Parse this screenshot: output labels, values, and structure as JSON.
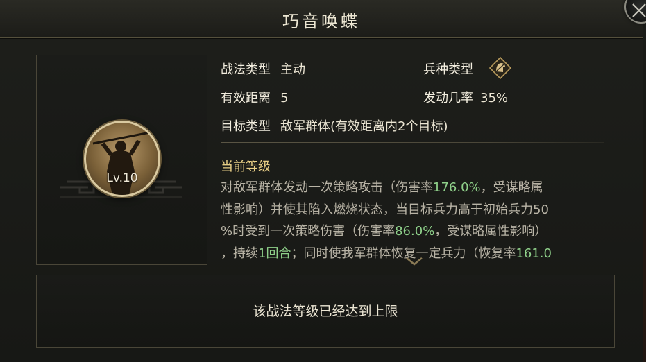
{
  "title": "巧音唤蝶",
  "portrait": {
    "level": "Lv.10"
  },
  "info": {
    "tactic_type_label": "战法类型",
    "tactic_type_value": "主动",
    "troop_type_label": "兵种类型",
    "troop_type_icon": "cavalry-helmet-icon",
    "range_label": "有效距离",
    "range_value": "5",
    "chance_label": "发动几率",
    "chance_value": "35%",
    "target_label": "目标类型",
    "target_value": "敌军群体(有效距离内2个目标)"
  },
  "current_level_label": "当前等级",
  "description": {
    "line1_a": "对敌军群体发动一次策略攻击（伤害率",
    "line1_g": "176.0%",
    "line1_b": "，受谋略属",
    "line2": "性影响）并使其陷入燃烧状态，当目标兵力高于初始兵力50",
    "line3_a": "%时受到一次策略伤害（伤害率",
    "line3_g": "86.0%",
    "line3_b": "，受谋略属性影响）",
    "line4_a": "，持续",
    "line4_g": "1回合",
    "line4_b": "；同时使我军群体恢复一定兵力（恢复率",
    "line4_g2": "161.0"
  },
  "max_level_message": "该战法等级已经达到上限",
  "colors": {
    "highlight_green": "#8fd08a",
    "section_gold": "#e8cf86"
  }
}
